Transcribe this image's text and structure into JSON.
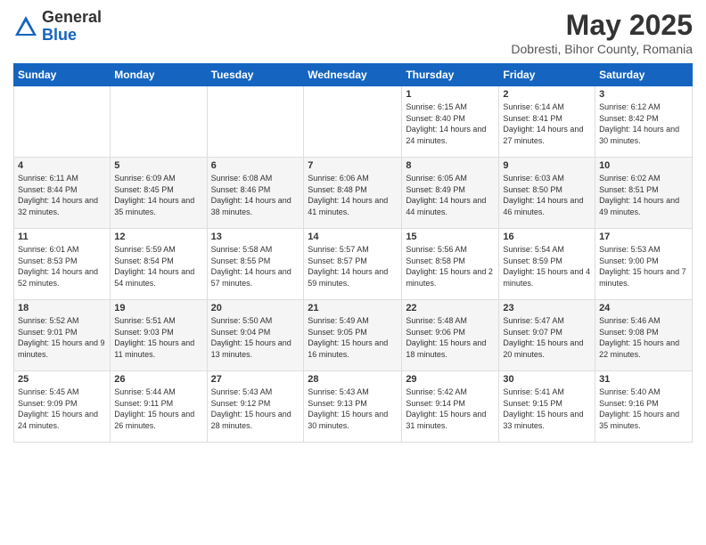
{
  "header": {
    "logo_general": "General",
    "logo_blue": "Blue",
    "month_title": "May 2025",
    "subtitle": "Dobresti, Bihor County, Romania"
  },
  "days_of_week": [
    "Sunday",
    "Monday",
    "Tuesday",
    "Wednesday",
    "Thursday",
    "Friday",
    "Saturday"
  ],
  "weeks": [
    [
      {
        "day": "",
        "sunrise": "",
        "sunset": "",
        "daylight": ""
      },
      {
        "day": "",
        "sunrise": "",
        "sunset": "",
        "daylight": ""
      },
      {
        "day": "",
        "sunrise": "",
        "sunset": "",
        "daylight": ""
      },
      {
        "day": "",
        "sunrise": "",
        "sunset": "",
        "daylight": ""
      },
      {
        "day": "1",
        "sunrise": "6:15 AM",
        "sunset": "8:40 PM",
        "daylight": "14 hours and 24 minutes."
      },
      {
        "day": "2",
        "sunrise": "6:14 AM",
        "sunset": "8:41 PM",
        "daylight": "14 hours and 27 minutes."
      },
      {
        "day": "3",
        "sunrise": "6:12 AM",
        "sunset": "8:42 PM",
        "daylight": "14 hours and 30 minutes."
      }
    ],
    [
      {
        "day": "4",
        "sunrise": "6:11 AM",
        "sunset": "8:44 PM",
        "daylight": "14 hours and 32 minutes."
      },
      {
        "day": "5",
        "sunrise": "6:09 AM",
        "sunset": "8:45 PM",
        "daylight": "14 hours and 35 minutes."
      },
      {
        "day": "6",
        "sunrise": "6:08 AM",
        "sunset": "8:46 PM",
        "daylight": "14 hours and 38 minutes."
      },
      {
        "day": "7",
        "sunrise": "6:06 AM",
        "sunset": "8:48 PM",
        "daylight": "14 hours and 41 minutes."
      },
      {
        "day": "8",
        "sunrise": "6:05 AM",
        "sunset": "8:49 PM",
        "daylight": "14 hours and 44 minutes."
      },
      {
        "day": "9",
        "sunrise": "6:03 AM",
        "sunset": "8:50 PM",
        "daylight": "14 hours and 46 minutes."
      },
      {
        "day": "10",
        "sunrise": "6:02 AM",
        "sunset": "8:51 PM",
        "daylight": "14 hours and 49 minutes."
      }
    ],
    [
      {
        "day": "11",
        "sunrise": "6:01 AM",
        "sunset": "8:53 PM",
        "daylight": "14 hours and 52 minutes."
      },
      {
        "day": "12",
        "sunrise": "5:59 AM",
        "sunset": "8:54 PM",
        "daylight": "14 hours and 54 minutes."
      },
      {
        "day": "13",
        "sunrise": "5:58 AM",
        "sunset": "8:55 PM",
        "daylight": "14 hours and 57 minutes."
      },
      {
        "day": "14",
        "sunrise": "5:57 AM",
        "sunset": "8:57 PM",
        "daylight": "14 hours and 59 minutes."
      },
      {
        "day": "15",
        "sunrise": "5:56 AM",
        "sunset": "8:58 PM",
        "daylight": "15 hours and 2 minutes."
      },
      {
        "day": "16",
        "sunrise": "5:54 AM",
        "sunset": "8:59 PM",
        "daylight": "15 hours and 4 minutes."
      },
      {
        "day": "17",
        "sunrise": "5:53 AM",
        "sunset": "9:00 PM",
        "daylight": "15 hours and 7 minutes."
      }
    ],
    [
      {
        "day": "18",
        "sunrise": "5:52 AM",
        "sunset": "9:01 PM",
        "daylight": "15 hours and 9 minutes."
      },
      {
        "day": "19",
        "sunrise": "5:51 AM",
        "sunset": "9:03 PM",
        "daylight": "15 hours and 11 minutes."
      },
      {
        "day": "20",
        "sunrise": "5:50 AM",
        "sunset": "9:04 PM",
        "daylight": "15 hours and 13 minutes."
      },
      {
        "day": "21",
        "sunrise": "5:49 AM",
        "sunset": "9:05 PM",
        "daylight": "15 hours and 16 minutes."
      },
      {
        "day": "22",
        "sunrise": "5:48 AM",
        "sunset": "9:06 PM",
        "daylight": "15 hours and 18 minutes."
      },
      {
        "day": "23",
        "sunrise": "5:47 AM",
        "sunset": "9:07 PM",
        "daylight": "15 hours and 20 minutes."
      },
      {
        "day": "24",
        "sunrise": "5:46 AM",
        "sunset": "9:08 PM",
        "daylight": "15 hours and 22 minutes."
      }
    ],
    [
      {
        "day": "25",
        "sunrise": "5:45 AM",
        "sunset": "9:09 PM",
        "daylight": "15 hours and 24 minutes."
      },
      {
        "day": "26",
        "sunrise": "5:44 AM",
        "sunset": "9:11 PM",
        "daylight": "15 hours and 26 minutes."
      },
      {
        "day": "27",
        "sunrise": "5:43 AM",
        "sunset": "9:12 PM",
        "daylight": "15 hours and 28 minutes."
      },
      {
        "day": "28",
        "sunrise": "5:43 AM",
        "sunset": "9:13 PM",
        "daylight": "15 hours and 30 minutes."
      },
      {
        "day": "29",
        "sunrise": "5:42 AM",
        "sunset": "9:14 PM",
        "daylight": "15 hours and 31 minutes."
      },
      {
        "day": "30",
        "sunrise": "5:41 AM",
        "sunset": "9:15 PM",
        "daylight": "15 hours and 33 minutes."
      },
      {
        "day": "31",
        "sunrise": "5:40 AM",
        "sunset": "9:16 PM",
        "daylight": "15 hours and 35 minutes."
      }
    ]
  ]
}
